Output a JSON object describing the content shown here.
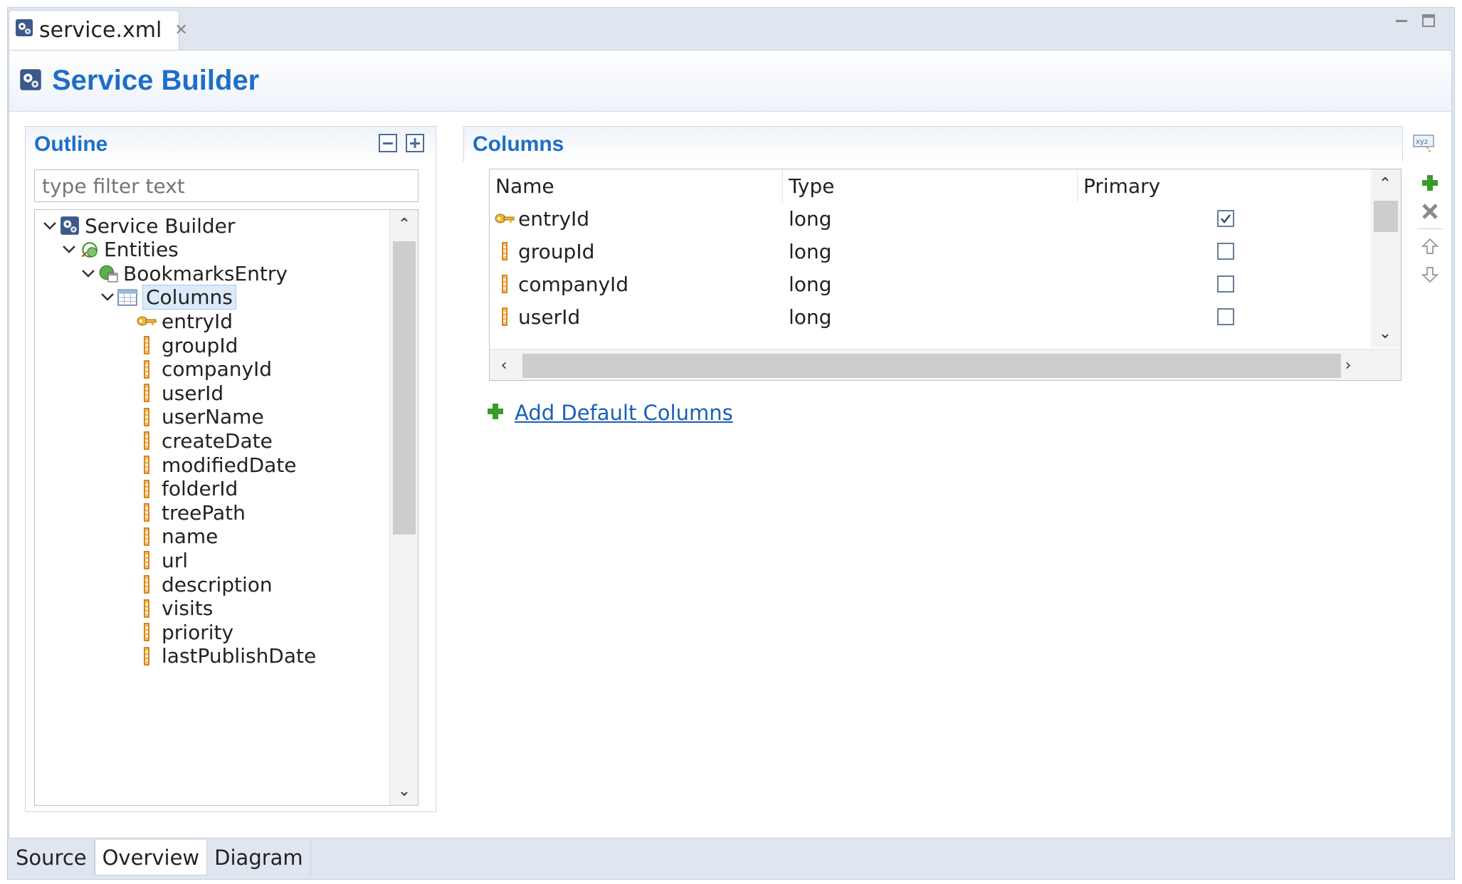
{
  "editor_tab": {
    "label": "service.xml",
    "close_glyph": "✕"
  },
  "header": {
    "title": "Service Builder"
  },
  "outline": {
    "title": "Outline",
    "filter_placeholder": "type filter text",
    "tree": [
      {
        "label": "Service Builder",
        "level": 0,
        "expanded": true,
        "icon": "service-builder-gear-icon"
      },
      {
        "label": "Entities",
        "level": 1,
        "expanded": true,
        "icon": "entities-icon"
      },
      {
        "label": "BookmarksEntry",
        "level": 2,
        "expanded": true,
        "icon": "entity-icon"
      },
      {
        "label": "Columns",
        "level": 3,
        "expanded": true,
        "icon": "columns-table-icon",
        "selected": true
      },
      {
        "label": "entryId",
        "level": 4,
        "icon": "primary-key-icon"
      },
      {
        "label": "groupId",
        "level": 4,
        "icon": "column-icon"
      },
      {
        "label": "companyId",
        "level": 4,
        "icon": "column-icon"
      },
      {
        "label": "userId",
        "level": 4,
        "icon": "column-icon"
      },
      {
        "label": "userName",
        "level": 4,
        "icon": "column-icon"
      },
      {
        "label": "createDate",
        "level": 4,
        "icon": "column-icon"
      },
      {
        "label": "modifiedDate",
        "level": 4,
        "icon": "column-icon"
      },
      {
        "label": "folderId",
        "level": 4,
        "icon": "column-icon"
      },
      {
        "label": "treePath",
        "level": 4,
        "icon": "column-icon"
      },
      {
        "label": "name",
        "level": 4,
        "icon": "column-icon"
      },
      {
        "label": "url",
        "level": 4,
        "icon": "column-icon"
      },
      {
        "label": "description",
        "level": 4,
        "icon": "column-icon"
      },
      {
        "label": "visits",
        "level": 4,
        "icon": "column-icon"
      },
      {
        "label": "priority",
        "level": 4,
        "icon": "column-icon"
      },
      {
        "label": "lastPublishDate",
        "level": 4,
        "icon": "column-icon"
      }
    ]
  },
  "columns": {
    "title": "Columns",
    "headers": {
      "name": "Name",
      "type": "Type",
      "primary": "Primary"
    },
    "rows": [
      {
        "name": "entryId",
        "type": "long",
        "primary": true,
        "icon": "primary-key-icon"
      },
      {
        "name": "groupId",
        "type": "long",
        "primary": false,
        "icon": "column-icon"
      },
      {
        "name": "companyId",
        "type": "long",
        "primary": false,
        "icon": "column-icon"
      },
      {
        "name": "userId",
        "type": "long",
        "primary": false,
        "icon": "column-icon"
      }
    ],
    "add_default_label": "Add Default Columns"
  },
  "bottom_tabs": [
    {
      "label": "Source",
      "active": false
    },
    {
      "label": "Overview",
      "active": true
    },
    {
      "label": "Diagram",
      "active": false
    }
  ],
  "colors": {
    "accent": "#1d6fc7",
    "link": "#1a5fb4",
    "selection": "#dceafb",
    "column_icon": "#d8871a",
    "add_green": "#3a9a2a"
  }
}
